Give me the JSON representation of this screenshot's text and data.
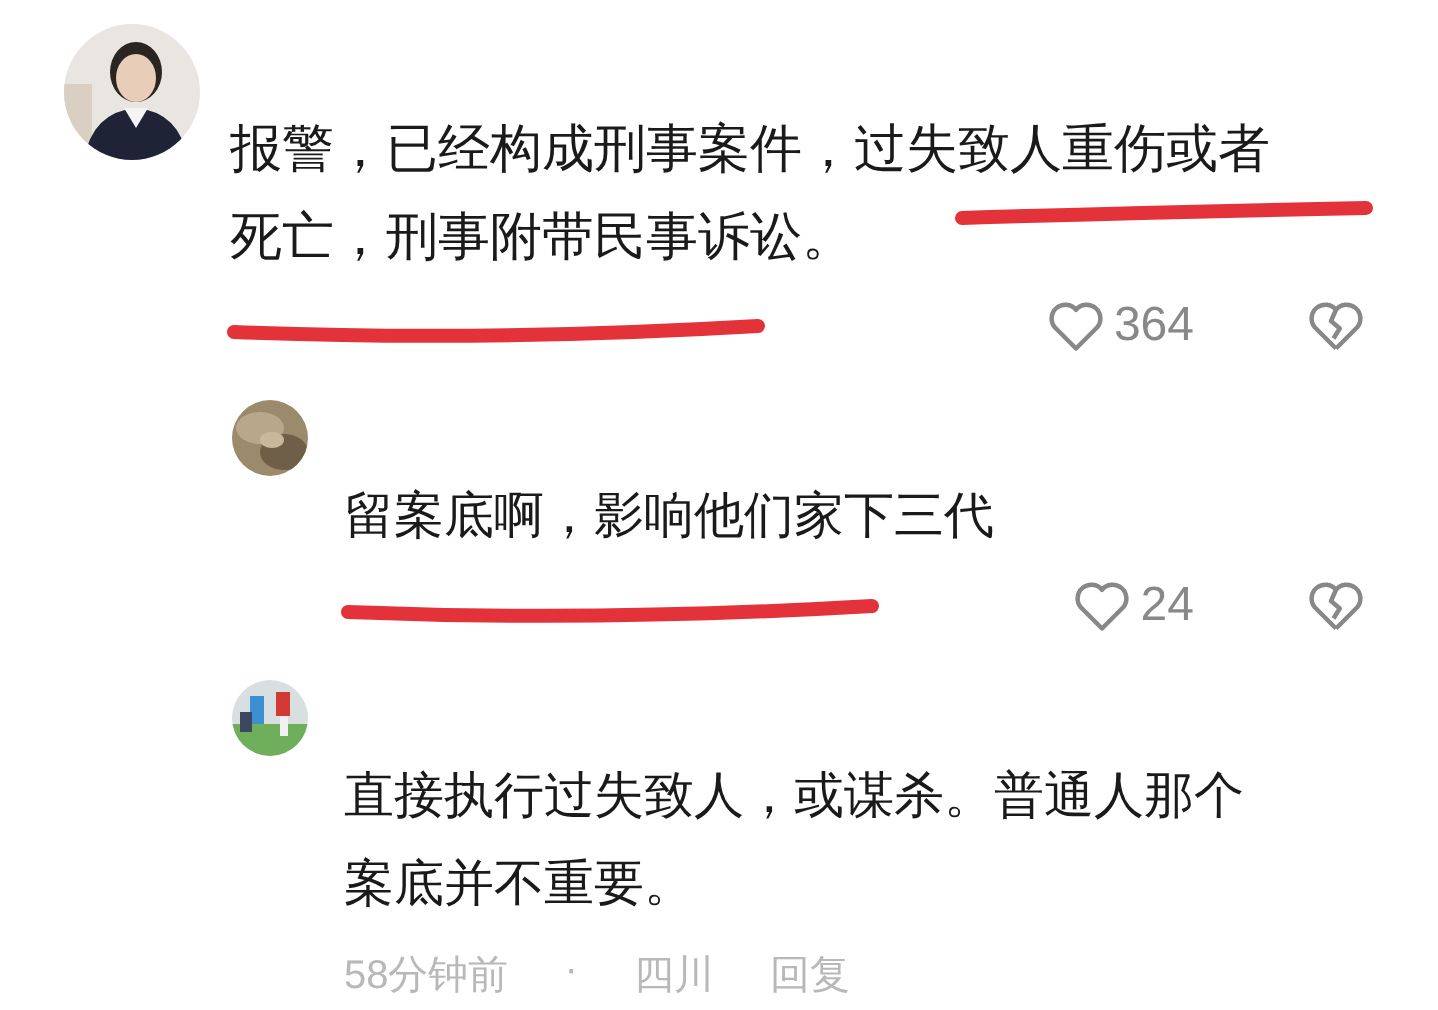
{
  "comments": [
    {
      "kind": "top",
      "lines": [
        "报警，已经构成刑事案件，过失致人重伤或者",
        "死亡，刑事附带民事诉讼。"
      ],
      "likes": "364",
      "text_struck": true,
      "meta_struck": true
    },
    {
      "kind": "reply",
      "lines": [
        "留案底啊，影响他们家下三代"
      ],
      "likes": "24",
      "text_struck": false,
      "meta_struck": true
    },
    {
      "kind": "reply",
      "lines": [
        "直接执行过失致人，或谋杀。普通人那个",
        "案底并不重要。"
      ],
      "meta": [
        "58分钟前",
        "·",
        "四川",
        "回复"
      ],
      "text_struck": false,
      "meta_struck": false
    }
  ]
}
